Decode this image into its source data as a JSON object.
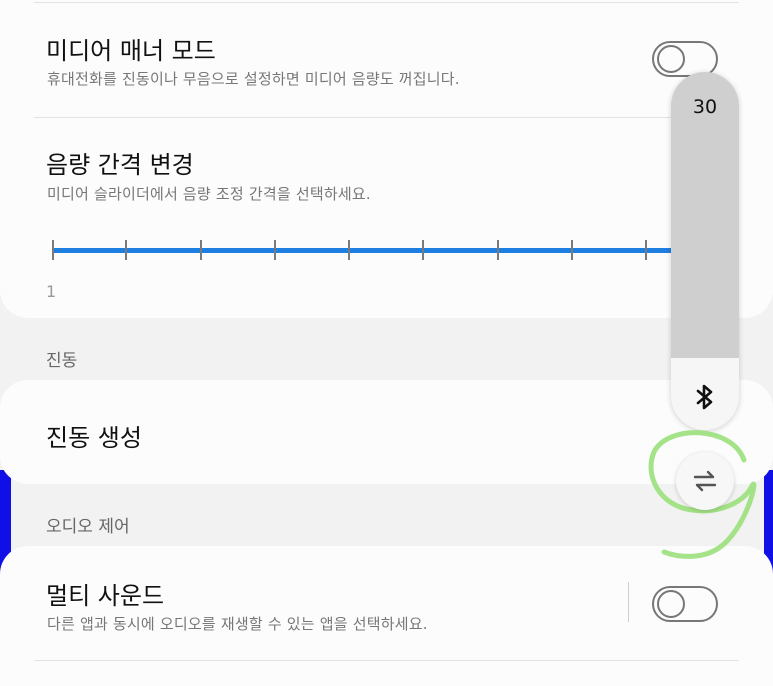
{
  "media_manner": {
    "title": "미디어 매너 모드",
    "description": "휴대전화를 진동이나 무음으로 설정하면 미디어 음량도 꺼집니다.",
    "enabled": false
  },
  "volume_step": {
    "title": "음량 간격 변경",
    "description": "미디어 슬라이더에서 음량 조정 간격을 선택하세요.",
    "min_label": "1",
    "value_fraction": 1.0
  },
  "vibration_section": {
    "label": "진동",
    "item_title": "진동 생성"
  },
  "audio_section": {
    "label": "오디오 제어",
    "multi_sound": {
      "title": "멀티 사운드",
      "description": "다른 앱과 동시에 오디오를 재생할 수 있는 앱을 선택하세요.",
      "enabled": false
    }
  },
  "volume_panel": {
    "value": "30",
    "level_fraction": 0.8,
    "output_icon": "bluetooth-icon",
    "switch_icon": "swap-arrows-icon"
  },
  "colors": {
    "accent": "#1f7fe0",
    "edge_bar": "#1010e6",
    "annotation": "#9ae07a"
  }
}
